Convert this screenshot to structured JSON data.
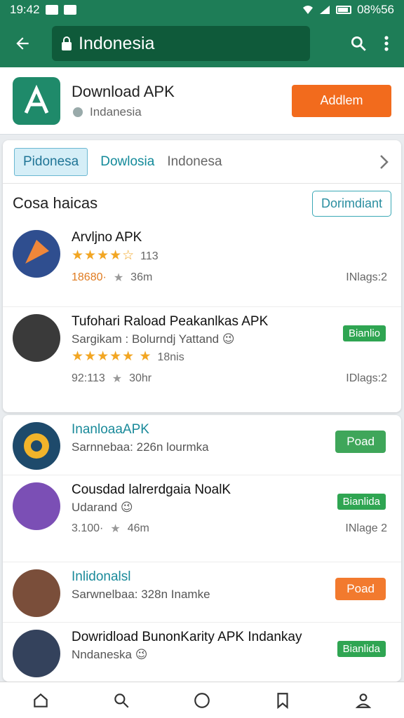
{
  "status_bar": {
    "time": "19:42",
    "battery": "08%56"
  },
  "app_bar": {
    "url": "Indonesia"
  },
  "header": {
    "title": "Download APK",
    "subtitle": "Indanesia",
    "button": "Addlem"
  },
  "tabs": [
    {
      "label": "Pidonesa"
    },
    {
      "label": "Dowlosia"
    },
    {
      "label": "Indonesa"
    }
  ],
  "section": {
    "title": "Cosa haicas",
    "button": "Dorimdiant"
  },
  "apps": [
    {
      "title": "Arvljno APK",
      "stars": "★★★★☆",
      "count": "113",
      "meta_left": "18680·",
      "meta_mid": "36m",
      "meta_right": "INlags:2",
      "avatar_color": "#2f4e8f"
    },
    {
      "title": "Tufohari Raload Peakanlkas APK",
      "subtitle": "Sargikam : Bolurndj Yattand 😉",
      "stars": "★★★★★ ★",
      "count": "18nis",
      "meta_left": "92:113",
      "meta_mid": "30hr",
      "meta_right": "IDlags:2",
      "badge": "Bianlio",
      "avatar_color": "#3a3a3a"
    },
    {
      "title": "InanloaaAPK",
      "subtitle": "Sarnnebaa: 226n lourmka",
      "button": "Poad",
      "button_color": "#3fa65a",
      "avatar_color": "#1e4a6b"
    },
    {
      "title": "Cousdad lalrerdgaia NoalK",
      "subtitle": "Udarand 😉",
      "meta_left": "3.100·",
      "meta_mid": "46m",
      "meta_right": "INlage 2",
      "badge": "Bianlida",
      "avatar_color": "#7b4fb5"
    },
    {
      "title": "Inlidonalsl",
      "subtitle": "Sarwnelbaa: 328n Inamke",
      "button": "Poad",
      "button_color": "#f27a2e",
      "avatar_color": "#7a4e3a"
    },
    {
      "title": "Dowridload BunonKarity APK Indankay",
      "subtitle": "Nndaneska 😉",
      "badge": "Bianlida",
      "avatar_color": "#34425c"
    }
  ]
}
